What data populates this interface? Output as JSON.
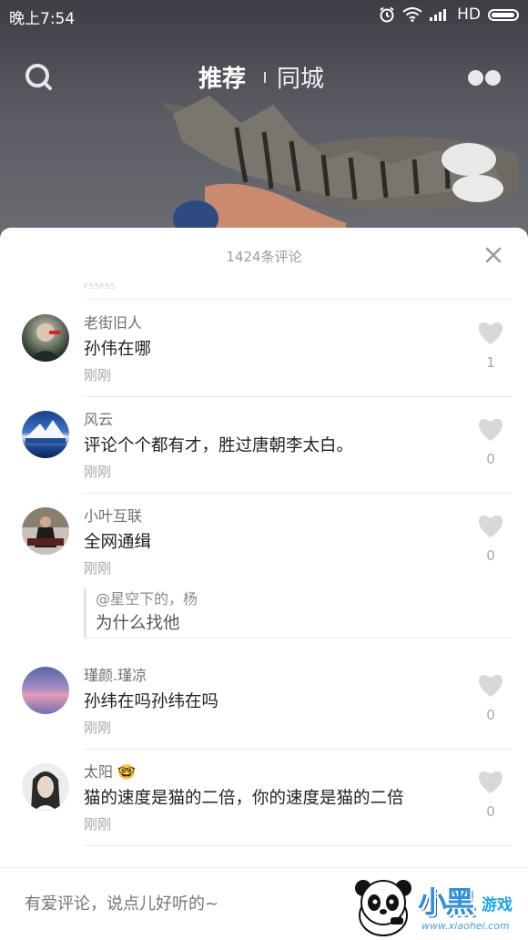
{
  "status_bar": {
    "time": "晚上7:54",
    "network": "HD"
  },
  "nav": {
    "tabs": [
      {
        "label": "推荐",
        "active": true
      },
      {
        "label": "同城",
        "active": false
      }
    ]
  },
  "comments_panel": {
    "title": "1424条评论",
    "prev_tail": "F55F55",
    "comments": [
      {
        "user": "老街旧人",
        "text": "孙伟在哪",
        "time": "刚刚",
        "likes": "1",
        "avatar": "dark-portrait"
      },
      {
        "user": "风云",
        "text": "评论个个都有才，胜过唐朝李太白。",
        "time": "刚刚",
        "likes": "0",
        "avatar": "mountain"
      },
      {
        "user": "小叶互联",
        "text": "全网通缉",
        "time": "刚刚",
        "likes": "0",
        "avatar": "suit-man",
        "reply": {
          "name": "@星空下的，杨",
          "text": "为什么找他"
        }
      },
      {
        "user": "瑾颜.瑾凉",
        "text": "孙纬在吗孙纬在吗",
        "time": "刚刚",
        "likes": "0",
        "avatar": "pink-sky"
      },
      {
        "user": "太阳",
        "name_emoji": "🤓",
        "text": "猫的速度是猫的二倍，你的速度是猫的二倍",
        "time": "刚刚",
        "likes": "0",
        "avatar": "girl-portrait"
      }
    ]
  },
  "bottom_bar": {
    "placeholder": "有爱评论，说点儿好听的~"
  },
  "watermark": {
    "big": "小黑",
    "small": "游戏",
    "url": "www.xiaohei.com"
  },
  "colors": {
    "panel_bg": "#ffffff",
    "meta_gray": "#a8a8a8",
    "text_dark": "#222222"
  }
}
